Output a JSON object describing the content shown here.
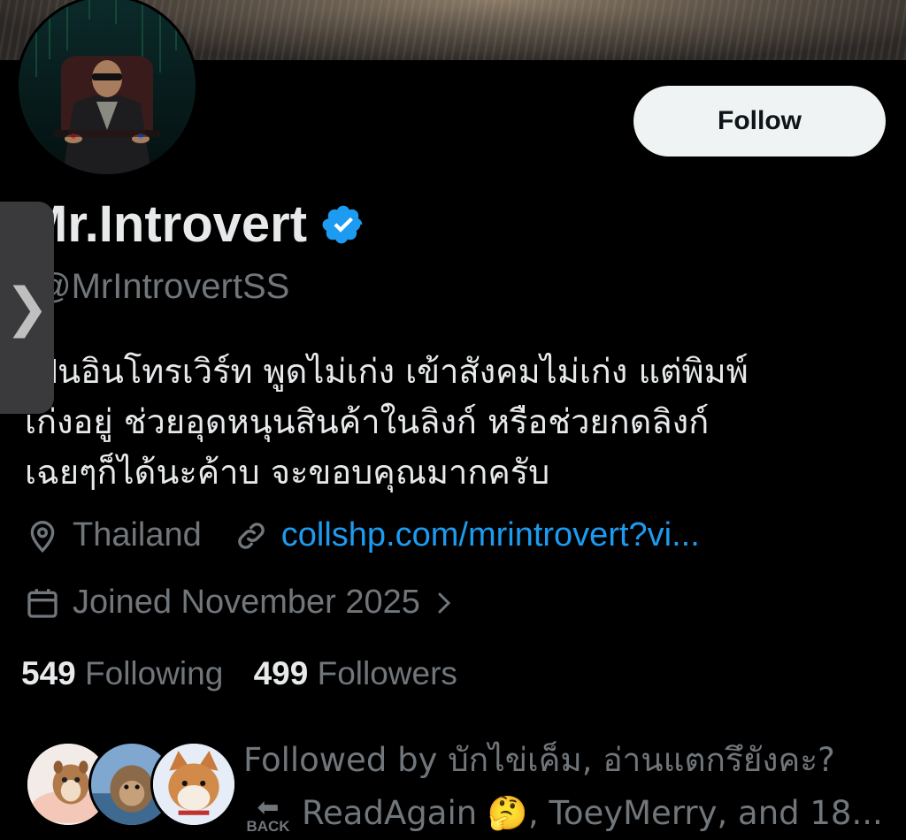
{
  "profile": {
    "name": "Mr.Introvert",
    "handle": "@MrIntrovertSS",
    "bio_lines": [
      "เป็นอินโทรเวิร์ท พูดไม่เก่ง เข้าสังคมไม่เก่ง แต่พิมพ์",
      "เก่งอยู่ ช่วยอุดหนุนสินค้าในลิงก์ หรือช่วยกดลิงก์",
      "เฉยๆก็ได้นะค้าบ จะขอบคุณมากครับ"
    ],
    "location": "Thailand",
    "link": "collshp.com/mrintrovert?vi...",
    "joined": "Joined November 2025",
    "following_count": "549",
    "following_label": "Following",
    "followers_count": "499",
    "followers_label": "Followers",
    "followed_by_line1": "Followed by บักไข่เค็ม, อ่านแตกรึยังคะ?",
    "followed_by_line2": "ReadAgain 🤔, ToeyMerry, and 18...",
    "back_label": "BACK"
  },
  "actions": {
    "follow_label": "Follow",
    "side_handle_glyph": "❯"
  },
  "icons": {
    "verified": "verified-badge-icon",
    "location": "location-pin-icon",
    "link": "link-icon",
    "calendar": "calendar-icon",
    "chevron": "chevron-right-icon"
  },
  "colors": {
    "background": "#000000",
    "text_primary": "#e7e9ea",
    "text_secondary": "#71767b",
    "accent": "#1d9bf0",
    "follow_bg": "#eff3f4"
  }
}
